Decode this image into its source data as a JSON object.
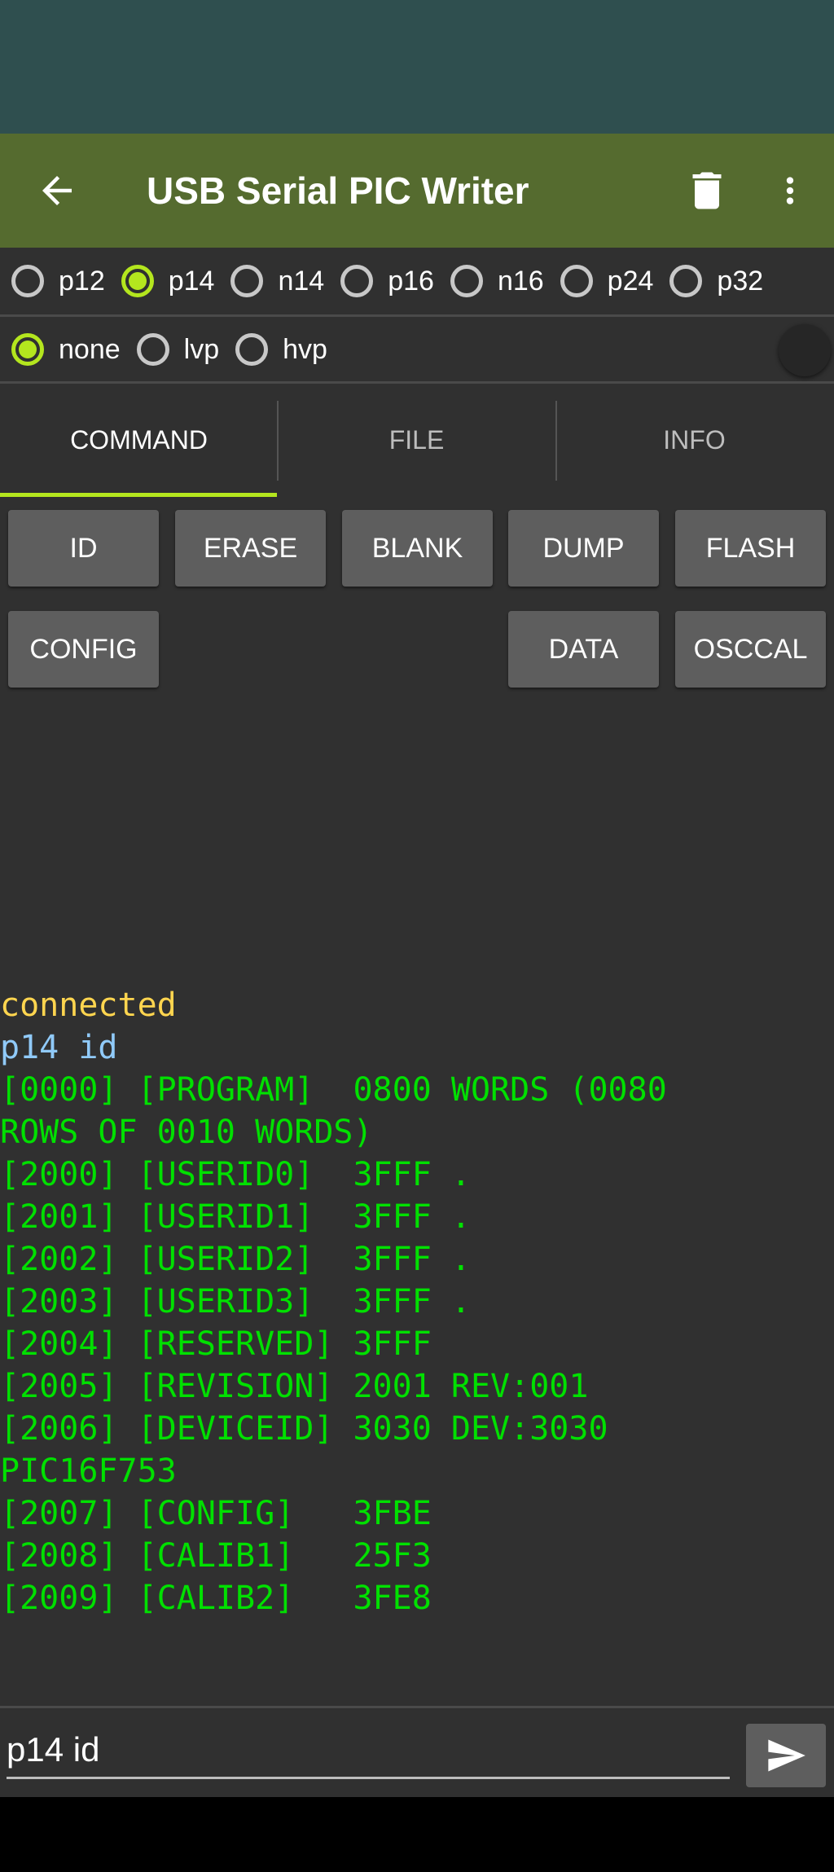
{
  "app": {
    "title": "USB Serial PIC Writer"
  },
  "toolbar_icons": {
    "back": "arrow-back-icon",
    "delete": "trash-icon",
    "menu": "more-vert-icon"
  },
  "device_options": [
    {
      "label": "p12",
      "selected": false
    },
    {
      "label": "p14",
      "selected": true
    },
    {
      "label": "n14",
      "selected": false
    },
    {
      "label": "p16",
      "selected": false
    },
    {
      "label": "n16",
      "selected": false
    },
    {
      "label": "p24",
      "selected": false
    },
    {
      "label": "p32",
      "selected": false
    }
  ],
  "voltage_options": [
    {
      "label": "none",
      "selected": true
    },
    {
      "label": "lvp",
      "selected": false
    },
    {
      "label": "hvp",
      "selected": false
    }
  ],
  "tabs": [
    {
      "label": "COMMAND",
      "active": true
    },
    {
      "label": "FILE",
      "active": false
    },
    {
      "label": "INFO",
      "active": false
    }
  ],
  "commands": {
    "id": "ID",
    "erase": "ERASE",
    "blank": "BLANK",
    "dump": "DUMP",
    "flash": "FLASH",
    "config": "CONFIG",
    "data": "DATA",
    "osccal": "OSCCAL"
  },
  "console": {
    "lines": [
      {
        "text": "connected",
        "color": "#ffd54f"
      },
      {
        "text": "p14 id",
        "color": "#90caf9"
      },
      {
        "text": "[0000] [PROGRAM]  0800 WORDS (0080",
        "color": "#00e000"
      },
      {
        "text": "ROWS OF 0010 WORDS)",
        "color": "#00e000"
      },
      {
        "text": "[2000] [USERID0]  3FFF .",
        "color": "#00e000"
      },
      {
        "text": "[2001] [USERID1]  3FFF .",
        "color": "#00e000"
      },
      {
        "text": "[2002] [USERID2]  3FFF .",
        "color": "#00e000"
      },
      {
        "text": "[2003] [USERID3]  3FFF .",
        "color": "#00e000"
      },
      {
        "text": "[2004] [RESERVED] 3FFF",
        "color": "#00e000"
      },
      {
        "text": "[2005] [REVISION] 2001 REV:001",
        "color": "#00e000"
      },
      {
        "text": "[2006] [DEVICEID] 3030 DEV:3030",
        "color": "#00e000"
      },
      {
        "text": "PIC16F753",
        "color": "#00e000"
      },
      {
        "text": "[2007] [CONFIG]   3FBE",
        "color": "#00e000"
      },
      {
        "text": "[2008] [CALIB1]   25F3",
        "color": "#00e000"
      },
      {
        "text": "[2009] [CALIB2]   3FE8",
        "color": "#00e000"
      }
    ]
  },
  "input": {
    "value": "p14 id",
    "send_icon": "send-icon"
  },
  "colors": {
    "accent": "#b4e61e",
    "toolbar": "#556b2f",
    "status_bar": "#2f4f4f",
    "background": "#303030"
  }
}
